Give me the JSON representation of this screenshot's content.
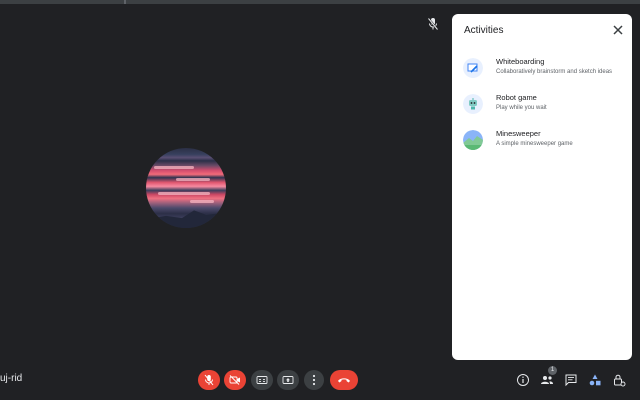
{
  "participant": {
    "name": "uj-rid"
  },
  "activities": {
    "title": "Activities",
    "items": [
      {
        "name": "Whiteboarding",
        "description": "Collaboratively brainstorm and sketch ideas",
        "icon": "whiteboard-icon"
      },
      {
        "name": "Robot game",
        "description": "Play while you wait",
        "icon": "robot-icon"
      },
      {
        "name": "Minesweeper",
        "description": "A simple minesweeper game",
        "icon": "minesweeper-icon"
      }
    ]
  },
  "toolbar": {
    "people_count": "1"
  },
  "colors": {
    "end_call": "#ea4335",
    "panel_bg": "#ffffff",
    "meeting_bg": "#202124"
  }
}
